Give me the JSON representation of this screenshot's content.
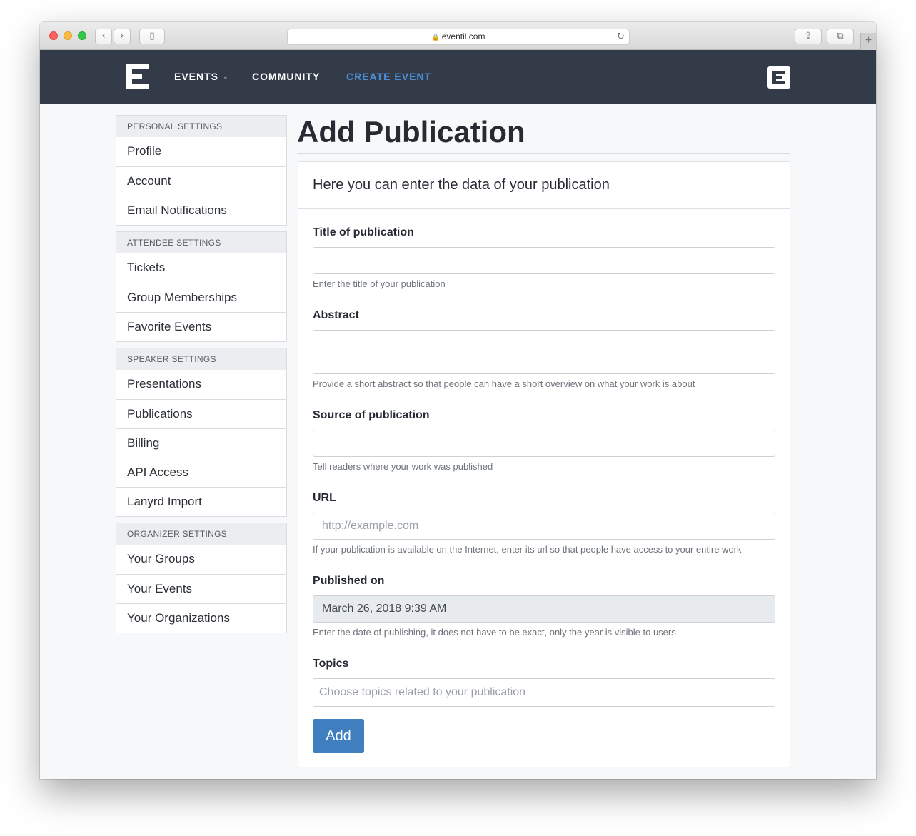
{
  "browser": {
    "url": "eventil.com",
    "back_glyph": "‹",
    "forward_glyph": "›",
    "sidebar_glyph": "▯",
    "share_glyph": "⇪",
    "tabs_glyph": "⧉",
    "reload_glyph": "↻",
    "lock_glyph": "🔒",
    "new_tab_glyph": "+"
  },
  "nav": {
    "events": "EVENTS",
    "community": "COMMUNITY",
    "create_event": "CREATE EVENT",
    "chevron": "⌄"
  },
  "sidebar": {
    "sections": [
      {
        "header": "PERSONAL SETTINGS",
        "items": [
          "Profile",
          "Account",
          "Email Notifications"
        ]
      },
      {
        "header": "ATTENDEE SETTINGS",
        "items": [
          "Tickets",
          "Group Memberships",
          "Favorite Events"
        ]
      },
      {
        "header": "SPEAKER SETTINGS",
        "items": [
          "Presentations",
          "Publications",
          "Billing",
          "API Access",
          "Lanyrd Import"
        ]
      },
      {
        "header": "ORGANIZER SETTINGS",
        "items": [
          "Your Groups",
          "Your Events",
          "Your Organizations"
        ]
      }
    ]
  },
  "page": {
    "title": "Add Publication",
    "card_header": "Here you can enter the data of your publication"
  },
  "form": {
    "title_label": "Title of publication",
    "title_value": "",
    "title_help": "Enter the title of your publication",
    "abstract_label": "Abstract",
    "abstract_value": "",
    "abstract_help": "Provide a short abstract so that people can have a short overview on what your work is about",
    "source_label": "Source of publication",
    "source_value": "",
    "source_help": "Tell readers where your work was published",
    "url_label": "URL",
    "url_placeholder": "http://example.com",
    "url_help": "If your publication is available on the Internet, enter its url so that people have access to your entire work",
    "published_label": "Published on",
    "published_value": "March 26, 2018 9:39 AM",
    "published_help": "Enter the date of publishing, it does not have to be exact, only the year is visible to users",
    "topics_label": "Topics",
    "topics_placeholder": "Choose topics related to your publication",
    "add_button": "Add"
  },
  "colors": {
    "navbar": "#333a48",
    "accent": "#4a90d9",
    "button": "#3f7fc0"
  }
}
